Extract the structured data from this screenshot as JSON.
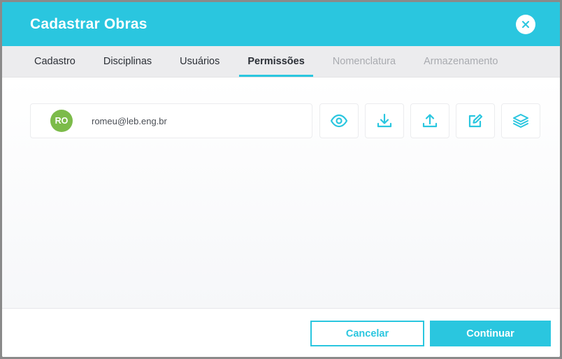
{
  "modal": {
    "title": "Cadastrar Obras",
    "close_icon": "close-icon"
  },
  "tabs": [
    {
      "label": "Cadastro",
      "state": "normal"
    },
    {
      "label": "Disciplinas",
      "state": "normal"
    },
    {
      "label": "Usuários",
      "state": "normal"
    },
    {
      "label": "Permissões",
      "state": "active"
    },
    {
      "label": "Nomenclatura",
      "state": "disabled"
    },
    {
      "label": "Armazenamento",
      "state": "disabled"
    }
  ],
  "user": {
    "initials": "RO",
    "email": "romeu@leb.eng.br",
    "avatar_color": "#7cbb4a"
  },
  "permissions": [
    {
      "icon": "eye-icon"
    },
    {
      "icon": "download-icon"
    },
    {
      "icon": "upload-icon"
    },
    {
      "icon": "edit-icon"
    },
    {
      "icon": "layers-icon"
    }
  ],
  "footer": {
    "cancel_label": "Cancelar",
    "continue_label": "Continuar"
  },
  "colors": {
    "accent": "#2ac6df",
    "tab_inactive": "#a9abb0"
  }
}
